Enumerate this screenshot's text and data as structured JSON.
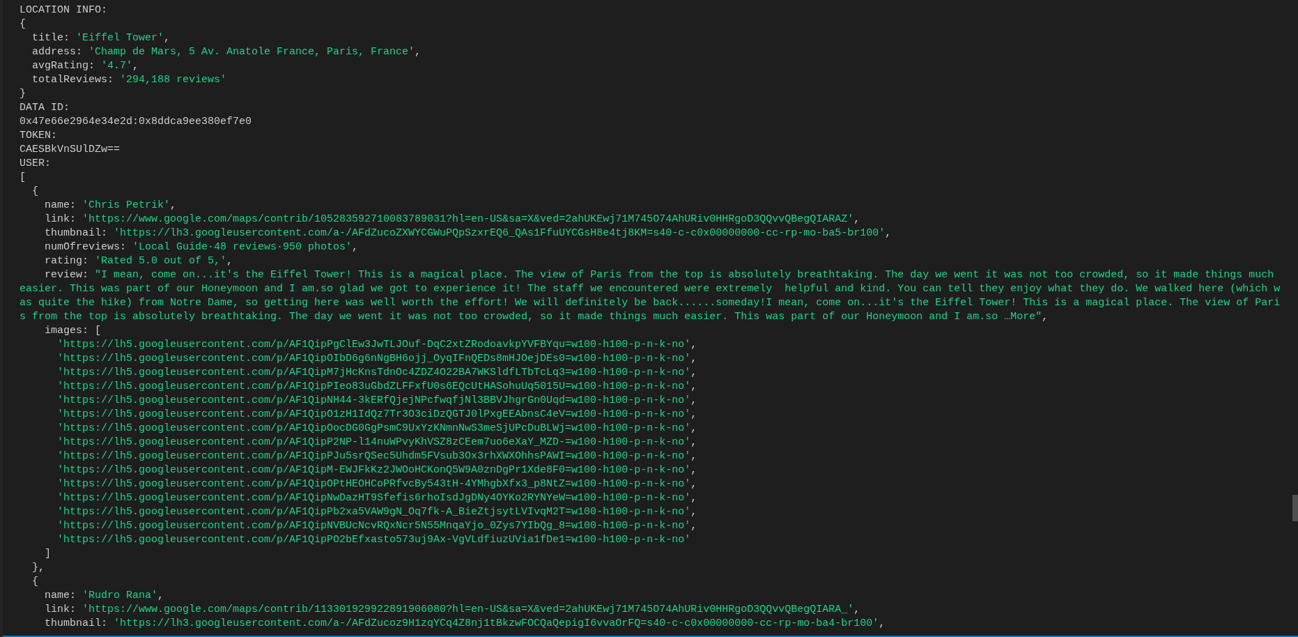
{
  "console": [
    {
      "kind": "text",
      "text": "LOCATION INFO:"
    },
    {
      "kind": "block",
      "open": "{",
      "close": "}",
      "children": [
        {
          "kind": "field",
          "key": "title:",
          "value": "'Eiffel Tower'",
          "tail": ","
        },
        {
          "kind": "field",
          "key": "address:",
          "value": "'Champ de Mars, 5 Av. Anatole France, Paris, France'",
          "tail": ","
        },
        {
          "kind": "field",
          "key": "avgRating:",
          "value": "'4.7'",
          "tail": ","
        },
        {
          "kind": "field",
          "key": "totalReviews:",
          "value": "'294,188 reviews'"
        }
      ]
    },
    {
      "kind": "text",
      "text": "DATA ID:"
    },
    {
      "kind": "text",
      "text": "0x47e66e2964e34e2d:0x8ddca9ee380ef7e0"
    },
    {
      "kind": "text",
      "text": "TOKEN:"
    },
    {
      "kind": "text",
      "text": "CAESBkVnSUlDZw=="
    },
    {
      "kind": "text",
      "text": "USER:"
    },
    {
      "kind": "block",
      "open": "[",
      "children": [
        {
          "kind": "block",
          "open": "{",
          "close": "},",
          "children": [
            {
              "kind": "field",
              "key": "name:",
              "value": "'Chris Petrik'",
              "tail": ","
            },
            {
              "kind": "field",
              "key": "link:",
              "value": "'https://www.google.com/maps/contrib/105283592710083789031?hl=en-US&sa=X&ved=2ahUKEwj71M745O74AhURiv0HHRgoD3QQvvQBegQIARAZ'",
              "tail": ","
            },
            {
              "kind": "field",
              "key": "thumbnail:",
              "value": "'https://lh3.googleusercontent.com/a-/AFdZucoZXWYCGWuPQpSzxrEQ6_QAs1FfuUYCGsH8e4tj8KM=s40-c-c0x00000000-cc-rp-mo-ba5-br100'",
              "tail": ","
            },
            {
              "kind": "field",
              "key": "numOfreviews:",
              "value": "'Local Guide·48 reviews·950 photos'",
              "tail": ","
            },
            {
              "kind": "field",
              "key": "rating:",
              "value": "'Rated 5.0 out of 5,'",
              "tail": ","
            },
            {
              "kind": "field",
              "key": "review:",
              "value": "\"I mean, come on...it's the Eiffel Tower! This is a magical place. The view of Paris from the top is absolutely breathtaking. The day we went it was not too crowded, so it made things much easier. This was part of our Honeymoon and I am.so glad we got to experience it! The staff we encountered were extremely  helpful and kind. You can tell they enjoy what they do. We walked here (which was quite the hike) from Notre Dame, so getting here was well worth the effort! We will definitely be back......someday!I mean, come on...it's the Eiffel Tower! This is a magical place. The view of Paris from the top is absolutely breathtaking. The day we went it was not too crowded, so it made things much easier. This was part of our Honeymoon and I am.so …More\"",
              "tail": ","
            },
            {
              "kind": "block",
              "key": "images:",
              "open": "[",
              "close": "]",
              "children": [
                {
                  "kind": "item",
                  "value": "'https://lh5.googleusercontent.com/p/AF1QipPgClEw3JwTLJOuf-DqC2xtZRodoavkpYVFBYqu=w100-h100-p-n-k-no'",
                  "tail": ","
                },
                {
                  "kind": "item",
                  "value": "'https://lh5.googleusercontent.com/p/AF1QipOIbD6g6nNgBH6ojj_OyqIFnQEDs8mHJOejDEs0=w100-h100-p-n-k-no'",
                  "tail": ","
                },
                {
                  "kind": "item",
                  "value": "'https://lh5.googleusercontent.com/p/AF1QipM7jHcKnsTdnOc4ZDZ4O22BA7WKSldfLTbTcLq3=w100-h100-p-n-k-no'",
                  "tail": ","
                },
                {
                  "kind": "item",
                  "value": "'https://lh5.googleusercontent.com/p/AF1QipPIeo83uGbdZLFFxfU0s6EQcUtHASohuUq5015U=w100-h100-p-n-k-no'",
                  "tail": ","
                },
                {
                  "kind": "item",
                  "value": "'https://lh5.googleusercontent.com/p/AF1QipNH44-3kERfQjejNPcfwqfjNl3BBVJhgrGn0Uqd=w100-h100-p-n-k-no'",
                  "tail": ","
                },
                {
                  "kind": "item",
                  "value": "'https://lh5.googleusercontent.com/p/AF1QipO1zH1IdQz7Tr3O3ciDzQGTJ0lPxgEEAbnsC4eV=w100-h100-p-n-k-no'",
                  "tail": ","
                },
                {
                  "kind": "item",
                  "value": "'https://lh5.googleusercontent.com/p/AF1QipOocDG0GgPsmC9UxYzKNmnNwS3meSjUPcDuBLWj=w100-h100-p-n-k-no'",
                  "tail": ","
                },
                {
                  "kind": "item",
                  "value": "'https://lh5.googleusercontent.com/p/AF1QipP2NP-l14nuWPvyKhVSZ8zCEem7uo6eXaY_MZD-=w100-h100-p-n-k-no'",
                  "tail": ","
                },
                {
                  "kind": "item",
                  "value": "'https://lh5.googleusercontent.com/p/AF1QipPJu5srQSec5Uhdm5FVsub3Ox3rhXWXOhhsPAWI=w100-h100-p-n-k-no'",
                  "tail": ","
                },
                {
                  "kind": "item",
                  "value": "'https://lh5.googleusercontent.com/p/AF1QipM-EWJFkKz2JWOoHCKonQ5W9A0znDgPr1Xde8F0=w100-h100-p-n-k-no'",
                  "tail": ","
                },
                {
                  "kind": "item",
                  "value": "'https://lh5.googleusercontent.com/p/AF1QipOPtHEOHCoPRfvcBy543tH-4YMhgbXfx3_p8NtZ=w100-h100-p-n-k-no'",
                  "tail": ","
                },
                {
                  "kind": "item",
                  "value": "'https://lh5.googleusercontent.com/p/AF1QipNwDazHT9Sfefis6rhoIsdJgDNy4OYKo2RYNYeW=w100-h100-p-n-k-no'",
                  "tail": ","
                },
                {
                  "kind": "item",
                  "value": "'https://lh5.googleusercontent.com/p/AF1QipPb2xa5VAW9gN_Oq7fk-A_BieZtjsytLVIvqM2T=w100-h100-p-n-k-no'",
                  "tail": ","
                },
                {
                  "kind": "item",
                  "value": "'https://lh5.googleusercontent.com/p/AF1QipNVBUcNcvRQxNcr5N55MnqaYjo_0Zys7YIbQg_8=w100-h100-p-n-k-no'",
                  "tail": ","
                },
                {
                  "kind": "item",
                  "value": "'https://lh5.googleusercontent.com/p/AF1QipPO2bEfxasto573uj9Ax-VgVLdfiuzUVia1fDe1=w100-h100-p-n-k-no'"
                }
              ]
            }
          ]
        },
        {
          "kind": "block",
          "open": "{",
          "children": [
            {
              "kind": "field",
              "key": "name:",
              "value": "'Rudro Rana'",
              "tail": ","
            },
            {
              "kind": "field",
              "key": "link:",
              "value": "'https://www.google.com/maps/contrib/113301929922891906080?hl=en-US&sa=X&ved=2ahUKEwj71M745O74AhURiv0HHRgoD3QQvvQBegQIARA_'",
              "tail": ","
            },
            {
              "kind": "field",
              "key": "thumbnail:",
              "value": "'https://lh3.googleusercontent.com/a-/AFdZucoz9H1zqYCq4Z8nj1tBkzwFOCQaQepigI6vvaOrFQ=s40-c-c0x00000000-cc-rp-mo-ba4-br100'",
              "tail": ","
            }
          ]
        }
      ]
    }
  ]
}
